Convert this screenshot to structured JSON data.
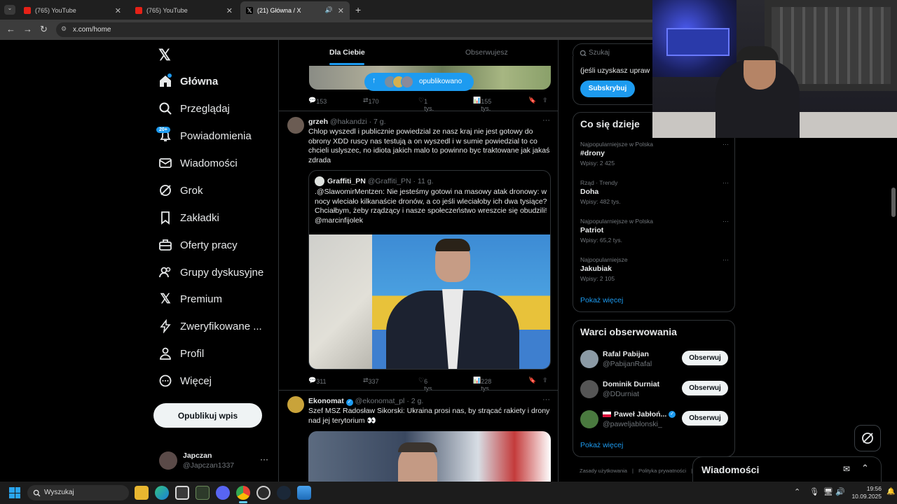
{
  "browser": {
    "tabs": [
      {
        "label": "(765) YouTube"
      },
      {
        "label": "(765) YouTube"
      },
      {
        "label": "(21) Główna / X"
      }
    ],
    "url": "x.com/home"
  },
  "nav": {
    "items": [
      {
        "label": "Główna",
        "icon": "home-icon"
      },
      {
        "label": "Przeglądaj",
        "icon": "search-icon"
      },
      {
        "label": "Powiadomienia",
        "icon": "bell-icon",
        "badge": "20+"
      },
      {
        "label": "Wiadomości",
        "icon": "mail-icon"
      },
      {
        "label": "Grok",
        "icon": "grok-icon"
      },
      {
        "label": "Zakładki",
        "icon": "bookmark-icon"
      },
      {
        "label": "Oferty pracy",
        "icon": "briefcase-icon"
      },
      {
        "label": "Grupy dyskusyjne",
        "icon": "people-icon"
      },
      {
        "label": "Premium",
        "icon": "x-icon"
      },
      {
        "label": "Zweryfikowane ...",
        "icon": "lightning-icon"
      },
      {
        "label": "Profil",
        "icon": "person-icon"
      },
      {
        "label": "Więcej",
        "icon": "more-circle-icon"
      }
    ],
    "publish_label": "Opublikuj wpis",
    "account": {
      "name": "Japczan",
      "handle": "@Japczan1337"
    }
  },
  "feed": {
    "tabs": [
      {
        "label": "Dla Ciebie"
      },
      {
        "label": "Obserwujesz"
      }
    ],
    "new_posts_label": "opublikowano",
    "posts": [
      {
        "stats": {
          "replies": "153",
          "reposts": "170",
          "likes": "1 tys.",
          "views": "155 tys."
        }
      },
      {
        "author": "grzeh",
        "handle": "@hakandzi",
        "time": "· 7 g.",
        "text": "Chlop wyszedl i publicznie powiedzial ze nasz kraj nie jest gotowy do obrony XDD ruscy nas testują a on wyszedl i w sumie powiedzial to co chcieli uslyszec, no idiota jakich malo to powinno byc traktowane jak jakaś zdrada",
        "quote": {
          "author": "Graffiti_PN",
          "handle": "@Graffiti_PN",
          "time": "· 11 g.",
          "text": ".@SlawomirMentzen: Nie jesteśmy gotowi na masowy atak dronowy: w nocy wleciało kilkanaście dronów, a co jeśli wleciałoby ich dwa tysiące? Chciałbym, żeby rządzący i nasze społeczeństwo wreszcie się obudzili! @marcinfijolek"
        },
        "stats": {
          "replies": "311",
          "reposts": "337",
          "likes": "6 tys.",
          "views": "228 tys."
        }
      },
      {
        "author": "Ekonomat",
        "handle": "@ekonomat_pl",
        "time": "· 2 g.",
        "text": "Szef MSZ Radosław Sikorski: Ukraina prosi nas, by strącać rakiety i drony nad jej terytorium 👀"
      }
    ]
  },
  "sidebar": {
    "search_placeholder": "Szukaj",
    "premium_text": "(jeśli uzyskasz upraw",
    "subscribe_label": "Subskrybuj",
    "trends_title": "Co się dzieje",
    "trends": [
      {
        "meta": "Najpopularniejsze w Polska",
        "name": "#drony",
        "count": "Wpisy: 2 425"
      },
      {
        "meta": "Rząd · Trendy",
        "name": "Doha",
        "count": "Wpisy: 482 tys."
      },
      {
        "meta": "Najpopularniejsze w Polska",
        "name": "Patriot",
        "count": "Wpisy: 65,2 tys."
      },
      {
        "meta": "Najpopularniejsze",
        "name": "Jakubiak",
        "count": "Wpisy: 2 105"
      }
    ],
    "show_more": "Pokaż więcej",
    "follow_title": "Warci obserwowania",
    "suggestions": [
      {
        "name": "Rafal Pabijan",
        "handle": "@PabijanRafal"
      },
      {
        "name": "Dominik Durniat",
        "handle": "@DDurniat"
      },
      {
        "name": "Paweł Jabłoń...",
        "handle": "@paweljablonski_"
      }
    ],
    "follow_label": "Obserwuj",
    "show_more_2": "Pokaż więcej",
    "footer": [
      "Zasady użytkowania",
      "|",
      "Polityka prywatności",
      "|"
    ]
  },
  "messages_drawer": {
    "title": "Wiadomości"
  },
  "taskbar": {
    "search_placeholder": "Wyszukaj",
    "time": "19:56",
    "date": "10.09.2025"
  }
}
